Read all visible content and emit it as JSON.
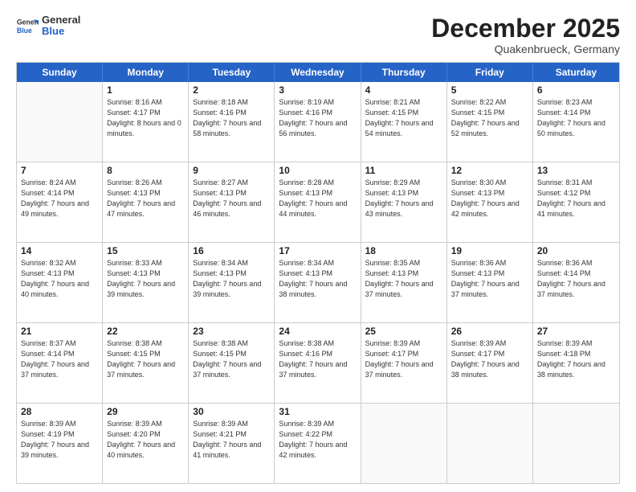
{
  "logo": {
    "general": "General",
    "blue": "Blue"
  },
  "header": {
    "month": "December 2025",
    "location": "Quakenbrueck, Germany"
  },
  "weekdays": [
    "Sunday",
    "Monday",
    "Tuesday",
    "Wednesday",
    "Thursday",
    "Friday",
    "Saturday"
  ],
  "weeks": [
    [
      {
        "day": "",
        "empty": true
      },
      {
        "day": "1",
        "rise": "8:16 AM",
        "set": "4:17 PM",
        "daylight": "8 hours and 0 minutes."
      },
      {
        "day": "2",
        "rise": "8:18 AM",
        "set": "4:16 PM",
        "daylight": "7 hours and 58 minutes."
      },
      {
        "day": "3",
        "rise": "8:19 AM",
        "set": "4:16 PM",
        "daylight": "7 hours and 56 minutes."
      },
      {
        "day": "4",
        "rise": "8:21 AM",
        "set": "4:15 PM",
        "daylight": "7 hours and 54 minutes."
      },
      {
        "day": "5",
        "rise": "8:22 AM",
        "set": "4:15 PM",
        "daylight": "7 hours and 52 minutes."
      },
      {
        "day": "6",
        "rise": "8:23 AM",
        "set": "4:14 PM",
        "daylight": "7 hours and 50 minutes."
      }
    ],
    [
      {
        "day": "7",
        "rise": "8:24 AM",
        "set": "4:14 PM",
        "daylight": "7 hours and 49 minutes."
      },
      {
        "day": "8",
        "rise": "8:26 AM",
        "set": "4:13 PM",
        "daylight": "7 hours and 47 minutes."
      },
      {
        "day": "9",
        "rise": "8:27 AM",
        "set": "4:13 PM",
        "daylight": "7 hours and 46 minutes."
      },
      {
        "day": "10",
        "rise": "8:28 AM",
        "set": "4:13 PM",
        "daylight": "7 hours and 44 minutes."
      },
      {
        "day": "11",
        "rise": "8:29 AM",
        "set": "4:13 PM",
        "daylight": "7 hours and 43 minutes."
      },
      {
        "day": "12",
        "rise": "8:30 AM",
        "set": "4:13 PM",
        "daylight": "7 hours and 42 minutes."
      },
      {
        "day": "13",
        "rise": "8:31 AM",
        "set": "4:12 PM",
        "daylight": "7 hours and 41 minutes."
      }
    ],
    [
      {
        "day": "14",
        "rise": "8:32 AM",
        "set": "4:13 PM",
        "daylight": "7 hours and 40 minutes."
      },
      {
        "day": "15",
        "rise": "8:33 AM",
        "set": "4:13 PM",
        "daylight": "7 hours and 39 minutes."
      },
      {
        "day": "16",
        "rise": "8:34 AM",
        "set": "4:13 PM",
        "daylight": "7 hours and 39 minutes."
      },
      {
        "day": "17",
        "rise": "8:34 AM",
        "set": "4:13 PM",
        "daylight": "7 hours and 38 minutes."
      },
      {
        "day": "18",
        "rise": "8:35 AM",
        "set": "4:13 PM",
        "daylight": "7 hours and 37 minutes."
      },
      {
        "day": "19",
        "rise": "8:36 AM",
        "set": "4:13 PM",
        "daylight": "7 hours and 37 minutes."
      },
      {
        "day": "20",
        "rise": "8:36 AM",
        "set": "4:14 PM",
        "daylight": "7 hours and 37 minutes."
      }
    ],
    [
      {
        "day": "21",
        "rise": "8:37 AM",
        "set": "4:14 PM",
        "daylight": "7 hours and 37 minutes."
      },
      {
        "day": "22",
        "rise": "8:38 AM",
        "set": "4:15 PM",
        "daylight": "7 hours and 37 minutes."
      },
      {
        "day": "23",
        "rise": "8:38 AM",
        "set": "4:15 PM",
        "daylight": "7 hours and 37 minutes."
      },
      {
        "day": "24",
        "rise": "8:38 AM",
        "set": "4:16 PM",
        "daylight": "7 hours and 37 minutes."
      },
      {
        "day": "25",
        "rise": "8:39 AM",
        "set": "4:17 PM",
        "daylight": "7 hours and 37 minutes."
      },
      {
        "day": "26",
        "rise": "8:39 AM",
        "set": "4:17 PM",
        "daylight": "7 hours and 38 minutes."
      },
      {
        "day": "27",
        "rise": "8:39 AM",
        "set": "4:18 PM",
        "daylight": "7 hours and 38 minutes."
      }
    ],
    [
      {
        "day": "28",
        "rise": "8:39 AM",
        "set": "4:19 PM",
        "daylight": "7 hours and 39 minutes."
      },
      {
        "day": "29",
        "rise": "8:39 AM",
        "set": "4:20 PM",
        "daylight": "7 hours and 40 minutes."
      },
      {
        "day": "30",
        "rise": "8:39 AM",
        "set": "4:21 PM",
        "daylight": "7 hours and 41 minutes."
      },
      {
        "day": "31",
        "rise": "8:39 AM",
        "set": "4:22 PM",
        "daylight": "7 hours and 42 minutes."
      },
      {
        "day": "",
        "empty": true
      },
      {
        "day": "",
        "empty": true
      },
      {
        "day": "",
        "empty": true
      }
    ]
  ]
}
